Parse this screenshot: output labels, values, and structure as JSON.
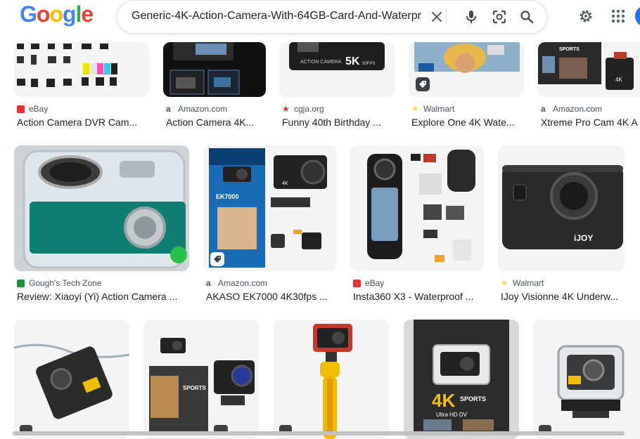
{
  "header": {
    "logo": [
      "G",
      "o",
      "o",
      "g",
      "l",
      "e"
    ],
    "logo_colors": [
      "#4285f4",
      "#ea4335",
      "#fbbc05",
      "#4285f4",
      "#34a853",
      "#ea4335"
    ],
    "query": "Generic-4K-Action-Camera-With-64GB-Card-And-Waterpr",
    "icons": [
      "close-icon",
      "microphone-icon",
      "lens-camera-icon",
      "search-icon",
      "settings-gear-icon",
      "apps-grid-icon"
    ]
  },
  "row1": [
    {
      "source": "eBay",
      "title": "Action Camera DVR Cam..."
    },
    {
      "source": "Amazon.com",
      "title": "Action Camera 4K..."
    },
    {
      "source": "cgja.org",
      "title": "Funny 40th Birthday ..."
    },
    {
      "source": "Walmart",
      "title": "Explore One 4K Wate..."
    },
    {
      "source": "Amazon.com",
      "title": "Xtreme Pro Cam 4K A"
    }
  ],
  "row2": [
    {
      "source": "Gough's Tech Zone",
      "title": "Review: Xiaoyi (Yi) Action Camera ..."
    },
    {
      "source": "Amazon.com",
      "title": "AKASO EK7000 4K30fps ..."
    },
    {
      "source": "eBay",
      "title": "Insta360 X3 - Waterproof ..."
    },
    {
      "source": "Walmart",
      "title": "IJoy Visionne 4K Underw..."
    }
  ],
  "thumb_text": {
    "five_k": "5K",
    "five_k_sub": "30FPS",
    "action_camera": "ACTION CAMERA",
    "ek7000": "EK7000",
    "sports": "SPORTS",
    "ultra_hd": "Ultra HD DV",
    "four_k": "4K",
    "ijoy": "iJOY"
  },
  "colors": {
    "brand_blue": "#1a73e8",
    "badge_dark": "#3c4043"
  }
}
